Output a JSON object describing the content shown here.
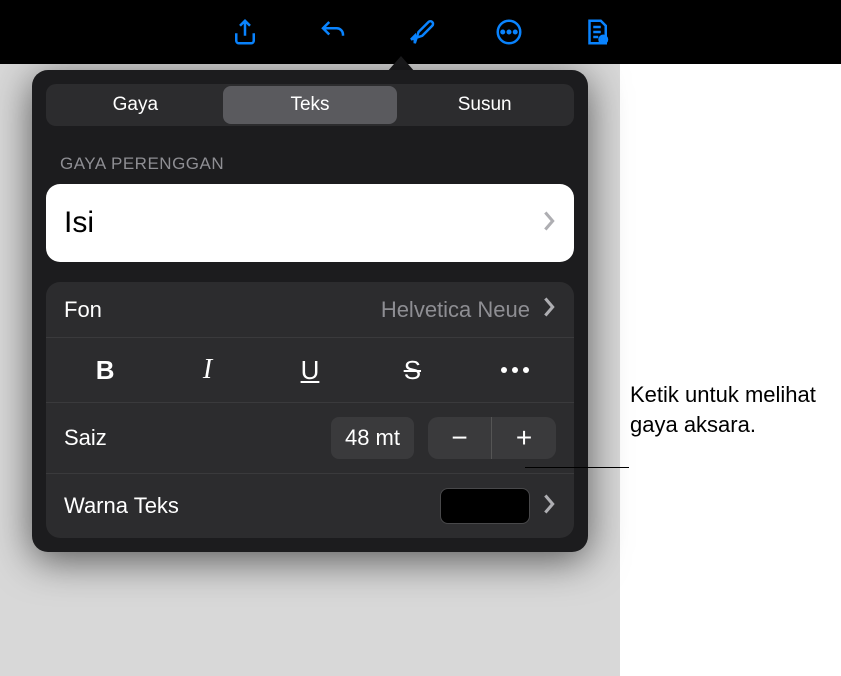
{
  "toolbar": {
    "icons": [
      "share",
      "undo",
      "format-brush",
      "more",
      "collaboration"
    ]
  },
  "tabs": {
    "items": [
      {
        "label": "Gaya"
      },
      {
        "label": "Teks"
      },
      {
        "label": "Susun"
      }
    ],
    "active_index": 1
  },
  "section_header": "GAYA PERENGGAN",
  "paragraph_style": {
    "label": "Isi"
  },
  "font": {
    "label": "Fon",
    "value": "Helvetica Neue"
  },
  "style_buttons": {
    "bold": "B",
    "italic": "I",
    "underline": "U",
    "strike": "S"
  },
  "size": {
    "label": "Saiz",
    "value": "48 mt"
  },
  "text_color": {
    "label": "Warna Teks",
    "value": "#000000"
  },
  "callout": {
    "text": "Ketik untuk melihat gaya aksara."
  }
}
